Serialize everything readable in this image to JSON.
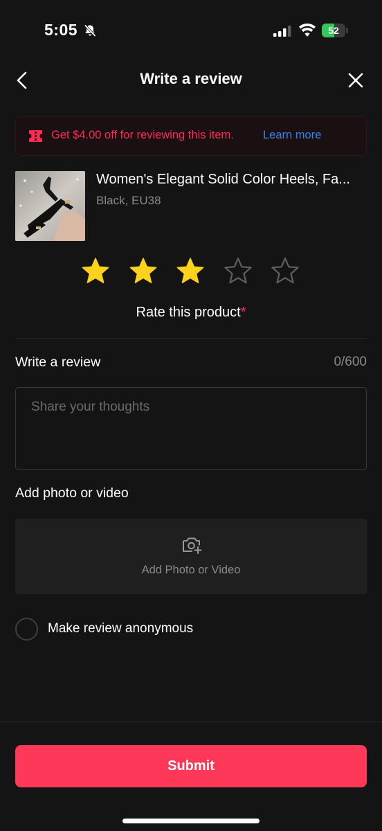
{
  "status_bar": {
    "time": "5:05",
    "battery_percent": "52",
    "battery_level": 0.52,
    "icons": [
      "bell-muted-icon",
      "signal-icon",
      "wifi-icon",
      "battery-icon"
    ]
  },
  "header": {
    "title": "Write a review",
    "back_icon": "chevron-left-icon",
    "close_icon": "close-icon"
  },
  "promo": {
    "icon": "coupon-icon",
    "text": "Get $4.00 off for reviewing this item.",
    "link": "Learn more",
    "color": "#fe2c55",
    "link_color": "#3b82e6"
  },
  "product": {
    "name": "Women's Elegant Solid Color Heels, Fa...",
    "variant": "Black, EU38"
  },
  "rating": {
    "value": 3,
    "max": 5,
    "label": "Rate this product",
    "required_mark": "*",
    "filled_color": "#fdd21a",
    "empty_color": "#5f5f5f"
  },
  "review": {
    "label": "Write a review",
    "counter": "0/600",
    "value": "",
    "placeholder": "Share your thoughts"
  },
  "media": {
    "label": "Add photo or video",
    "button_text": "Add Photo or Video",
    "icon": "camera-add-icon"
  },
  "anonymous": {
    "label": "Make review anonymous",
    "checked": false
  },
  "submit": {
    "label": "Submit",
    "color": "#fe3859"
  }
}
